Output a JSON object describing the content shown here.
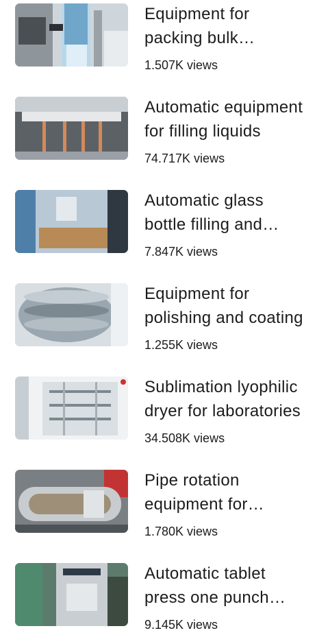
{
  "videos": [
    {
      "title": "Equipment for packing bulk products",
      "views": "1.507K views",
      "thumb_icon": "packing-machine-thumbnail"
    },
    {
      "title": "Automatic equipment for filling liquids",
      "views": "74.717K views",
      "thumb_icon": "filling-nozzles-thumbnail"
    },
    {
      "title": "Automatic glass bottle filling and capping",
      "views": "7.847K views",
      "thumb_icon": "bottle-filling-line-thumbnail"
    },
    {
      "title": "Equipment for polishing and coating",
      "views": "1.255K views",
      "thumb_icon": "polishing-drum-thumbnail"
    },
    {
      "title": "Sublimation lyophilic dryer for laboratories",
      "views": "34.508K views",
      "thumb_icon": "freeze-dryer-thumbnail"
    },
    {
      "title": "Pipe rotation equipment for coating",
      "views": "1.780K views",
      "thumb_icon": "rotating-pipe-thumbnail"
    },
    {
      "title": "Automatic tablet press one punch machine",
      "views": "9.145K views",
      "thumb_icon": "tablet-press-thumbnail"
    }
  ]
}
